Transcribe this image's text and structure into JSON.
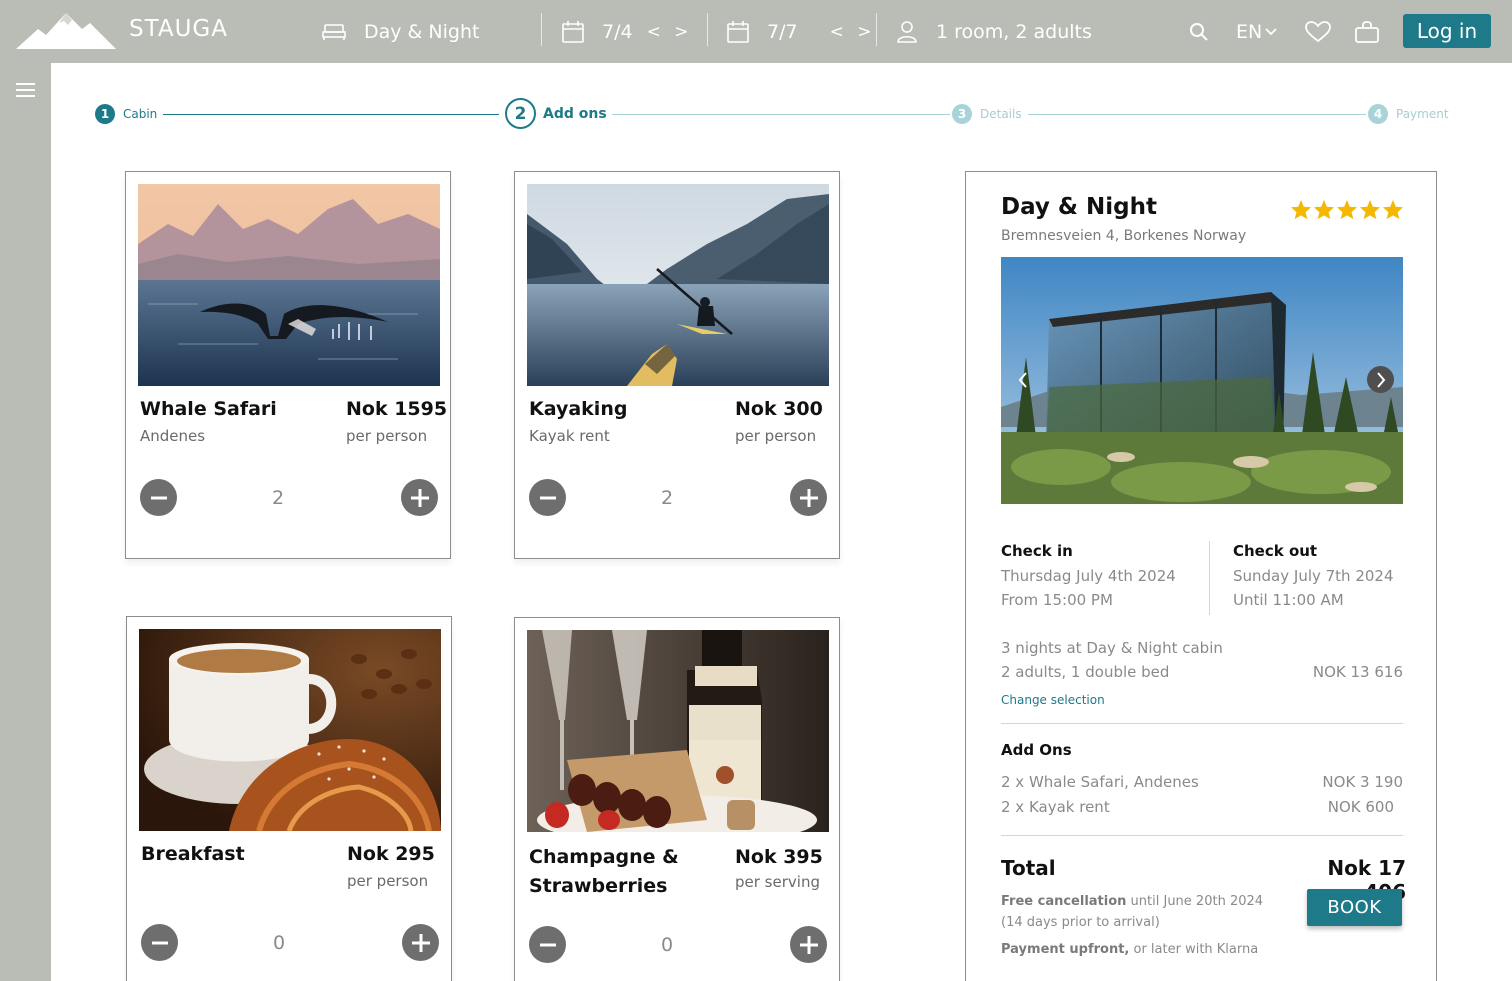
{
  "header": {
    "brand": "STAUGA",
    "cabin": "Day & Night",
    "checkin_date": "7/4",
    "checkout_date": "7/7",
    "guests": "1 room, 2 adults",
    "language": "EN",
    "login": "Log in",
    "arrows": "< >"
  },
  "steps": [
    {
      "number": "1",
      "label": "Cabin",
      "state": "done"
    },
    {
      "number": "2",
      "label": "Add ons",
      "state": "active"
    },
    {
      "number": "3",
      "label": "Details",
      "state": "upcoming"
    },
    {
      "number": "4",
      "label": "Payment",
      "state": "upcoming"
    }
  ],
  "addons": [
    {
      "title": "Whale Safari",
      "subtitle": "Andenes",
      "price": "Nok 1595",
      "unit": "per person",
      "quantity": "2"
    },
    {
      "title": "Kayaking",
      "subtitle": "Kayak rent",
      "price": "Nok 300",
      "unit": "per person",
      "quantity": "2"
    },
    {
      "title": "Breakfast",
      "subtitle": "",
      "price": "Nok 295",
      "unit": "per person",
      "quantity": "0"
    },
    {
      "title_line1": "Champagne &",
      "title_line2": "Strawberries",
      "subtitle": "",
      "price": "Nok 395",
      "unit": "per serving",
      "quantity": "0"
    }
  ],
  "summary": {
    "title": "Day & Night",
    "address": "Bremnesveien 4, Borkenes Norway",
    "rating": 5,
    "checkin": {
      "label": "Check in",
      "date": "Thursdag July 4th 2024",
      "time": "From 15:00 PM"
    },
    "checkout": {
      "label": "Check out",
      "date": "Sunday July 7th 2024",
      "time": "Until 11:00 AM"
    },
    "stay_line1": "3 nights at Day & Night cabin",
    "stay_line2": "2 adults, 1 double bed",
    "stay_price": "NOK 13 616",
    "change_selection": "Change selection",
    "addons_label": "Add Ons",
    "addon_lines": [
      {
        "text": "2 x  Whale Safari, Andenes",
        "price": "NOK 3 190"
      },
      {
        "text": "2 x  Kayak rent",
        "price": "NOK 600"
      }
    ],
    "total_label": "Total",
    "total_value": "Nok 17 406",
    "free_cancel_bold": "Free cancellation",
    "free_cancel_rest": " until June 20th 2024",
    "free_cancel_line2": "(14 days prior to arrival)",
    "payment_bold": "Payment upfront,",
    "payment_rest": " or later with Klarna",
    "book": "BOOK"
  },
  "colors": {
    "accent": "#1e7a88",
    "topbar": "#babcb6",
    "star": "#f5b800"
  }
}
